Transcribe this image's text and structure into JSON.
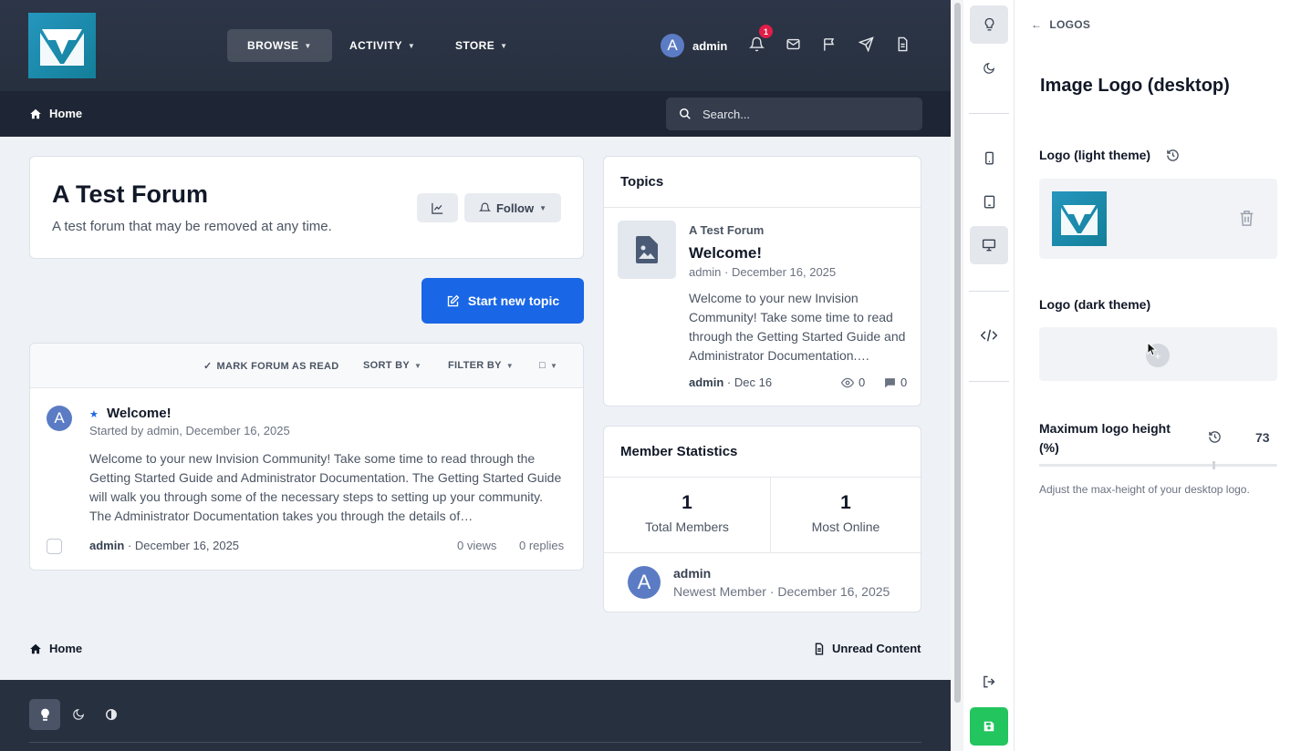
{
  "nav": {
    "browse": "BROWSE",
    "activity": "ACTIVITY",
    "store": "STORE",
    "user_initial": "A",
    "user_name": "admin",
    "notification_count": "1"
  },
  "breadcrumb": {
    "home": "Home"
  },
  "search": {
    "placeholder": "Search..."
  },
  "forum": {
    "title": "A Test Forum",
    "description": "A test forum that may be removed at any time.",
    "follow_label": "Follow",
    "new_topic_label": "Start new topic"
  },
  "toolbar": {
    "mark_read": "MARK FORUM AS READ",
    "sort_by": "SORT BY",
    "filter_by": "FILTER BY"
  },
  "topic_row": {
    "avatar_initial": "A",
    "title": "Welcome!",
    "meta": "Started by admin, December 16, 2025",
    "body": "Welcome to your new Invision Community! Take some time to read through the Getting Started Guide and Administrator Documentation. The Getting Started Guide will walk you through some of the necessary steps to setting up your community. The Administrator Documentation takes you through the details of…",
    "author": "admin",
    "date": "December 16, 2025",
    "views": "0 views",
    "replies": "0 replies"
  },
  "topics_widget": {
    "heading": "Topics",
    "forum": "A Test Forum",
    "title": "Welcome!",
    "meta": "admin · December 16, 2025",
    "body": "Welcome to your new Invision Community! Take some time to read through the Getting Started Guide and Administrator Documentation.…",
    "author": "admin",
    "date": "Dec 16",
    "views": "0",
    "replies": "0"
  },
  "member_stats": {
    "heading": "Member Statistics",
    "total_members": "1",
    "total_members_label": "Total Members",
    "most_online": "1",
    "most_online_label": "Most Online",
    "newest_initial": "A",
    "newest_name": "admin",
    "newest_meta": "Newest Member · December 16, 2025"
  },
  "footer": {
    "home": "Home",
    "unread": "Unread Content"
  },
  "panel": {
    "back_label": "LOGOS",
    "title": "Image Logo (desktop)",
    "light_label": "Logo (light theme)",
    "dark_label": "Logo (dark theme)",
    "height_label": "Maximum logo height (%)",
    "height_value": "73",
    "height_fraction": 0.73,
    "help": "Adjust the max-height of your desktop logo."
  },
  "colors": {
    "brand": "#1d8cab",
    "primary": "#1966e6",
    "header": "#2d3648",
    "save": "#22c55e",
    "badge": "#e11d48"
  }
}
